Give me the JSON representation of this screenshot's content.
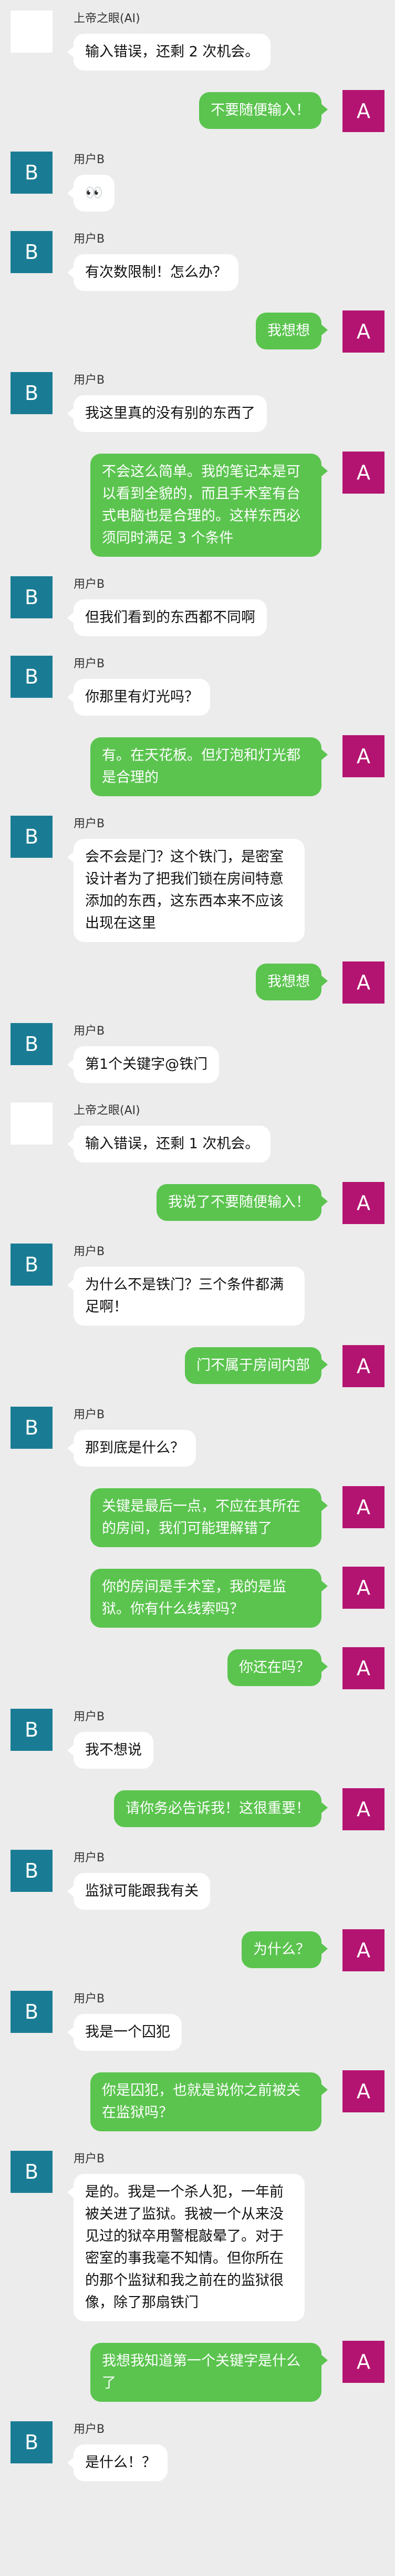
{
  "colors": {
    "background": "#ececec",
    "bot_avatar": "#ffffff",
    "user_b_avatar": "#1a7c94",
    "user_a_avatar": "#b41471",
    "incoming_bubble": "#ffffff",
    "outgoing_bubble": "#5bc44f"
  },
  "messages": [
    {
      "side": "left",
      "avatar": "blank",
      "avatar_label": "",
      "sender": "上帝之眼(AI)",
      "text": "输入错误，还剩 2 次机会。"
    },
    {
      "side": "right",
      "avatar": "a",
      "avatar_label": "A",
      "sender": "",
      "text": "不要随便输入！"
    },
    {
      "side": "left",
      "avatar": "b",
      "avatar_label": "B",
      "sender": "用户B",
      "text": "👀"
    },
    {
      "side": "left",
      "avatar": "b",
      "avatar_label": "B",
      "sender": "用户B",
      "text": "有次数限制！怎么办？"
    },
    {
      "side": "right",
      "avatar": "a",
      "avatar_label": "A",
      "sender": "",
      "text": "我想想"
    },
    {
      "side": "left",
      "avatar": "b",
      "avatar_label": "B",
      "sender": "用户B",
      "text": "我这里真的没有别的东西了"
    },
    {
      "side": "right",
      "avatar": "a",
      "avatar_label": "A",
      "sender": "",
      "text": "不会这么简单。我的笔记本是可以看到全貌的，而且手术室有台式电脑也是合理的。这样东西必须同时满足 3 个条件"
    },
    {
      "side": "left",
      "avatar": "b",
      "avatar_label": "B",
      "sender": "用户B",
      "text": "但我们看到的东西都不同啊"
    },
    {
      "side": "left",
      "avatar": "b",
      "avatar_label": "B",
      "sender": "用户B",
      "text": "你那里有灯光吗？"
    },
    {
      "side": "right",
      "avatar": "a",
      "avatar_label": "A",
      "sender": "",
      "text": "有。在天花板。但灯泡和灯光都是合理的"
    },
    {
      "side": "left",
      "avatar": "b",
      "avatar_label": "B",
      "sender": "用户B",
      "text": "会不会是门？这个铁门，是密室设计者为了把我们锁在房间特意添加的东西，这东西本来不应该出现在这里"
    },
    {
      "side": "right",
      "avatar": "a",
      "avatar_label": "A",
      "sender": "",
      "text": "我想想"
    },
    {
      "side": "left",
      "avatar": "b",
      "avatar_label": "B",
      "sender": "用户B",
      "text": "第1个关键字@铁门"
    },
    {
      "side": "left",
      "avatar": "blank",
      "avatar_label": "",
      "sender": "上帝之眼(AI)",
      "text": "输入错误，还剩 1 次机会。"
    },
    {
      "side": "right",
      "avatar": "a",
      "avatar_label": "A",
      "sender": "",
      "text": "我说了不要随便输入！"
    },
    {
      "side": "left",
      "avatar": "b",
      "avatar_label": "B",
      "sender": "用户B",
      "text": "为什么不是铁门？三个条件都满足啊！"
    },
    {
      "side": "right",
      "avatar": "a",
      "avatar_label": "A",
      "sender": "",
      "text": "门不属于房间内部"
    },
    {
      "side": "left",
      "avatar": "b",
      "avatar_label": "B",
      "sender": "用户B",
      "text": "那到底是什么？"
    },
    {
      "side": "right",
      "avatar": "a",
      "avatar_label": "A",
      "sender": "",
      "text": "关键是最后一点，不应在其所在的房间，我们可能理解错了"
    },
    {
      "side": "right",
      "avatar": "a",
      "avatar_label": "A",
      "sender": "",
      "text": "你的房间是手术室，我的是监狱。你有什么线索吗？"
    },
    {
      "side": "right",
      "avatar": "a",
      "avatar_label": "A",
      "sender": "",
      "text": "你还在吗？"
    },
    {
      "side": "left",
      "avatar": "b",
      "avatar_label": "B",
      "sender": "用户B",
      "text": "我不想说"
    },
    {
      "side": "right",
      "avatar": "a",
      "avatar_label": "A",
      "sender": "",
      "text": "请你务必告诉我！这很重要！"
    },
    {
      "side": "left",
      "avatar": "b",
      "avatar_label": "B",
      "sender": "用户B",
      "text": "监狱可能跟我有关"
    },
    {
      "side": "right",
      "avatar": "a",
      "avatar_label": "A",
      "sender": "",
      "text": "为什么？"
    },
    {
      "side": "left",
      "avatar": "b",
      "avatar_label": "B",
      "sender": "用户B",
      "text": "我是一个囚犯"
    },
    {
      "side": "right",
      "avatar": "a",
      "avatar_label": "A",
      "sender": "",
      "text": "你是囚犯，也就是说你之前被关在监狱吗？"
    },
    {
      "side": "left",
      "avatar": "b",
      "avatar_label": "B",
      "sender": "用户B",
      "text": "是的。我是一个杀人犯，一年前被关进了监狱。我被一个从来没见过的狱卒用警棍敲晕了。对于密室的事我毫不知情。但你所在的那个监狱和我之前在的监狱很像，除了那扇铁门"
    },
    {
      "side": "right",
      "avatar": "a",
      "avatar_label": "A",
      "sender": "",
      "text": "我想我知道第一个关键字是什么了"
    },
    {
      "side": "left",
      "avatar": "b",
      "avatar_label": "B",
      "sender": "用户B",
      "text": "是什么！？"
    }
  ]
}
